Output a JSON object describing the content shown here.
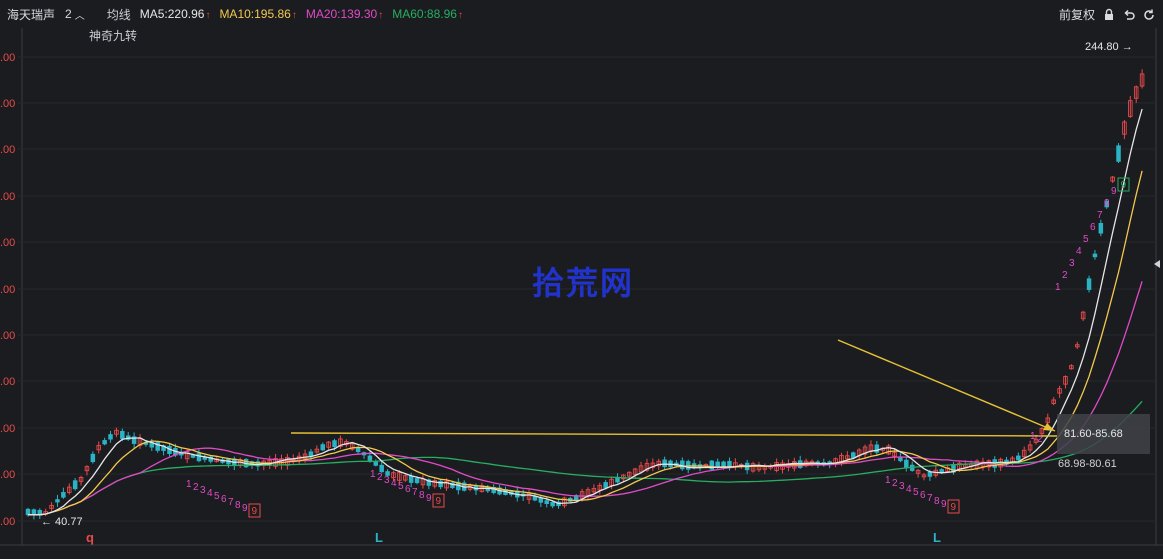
{
  "header": {
    "stock_name": "海天瑞声",
    "count_label": "2",
    "indicator_label": "均线",
    "ma_labels": [
      {
        "text": "MA5:220.96",
        "color": "#e6e6e6"
      },
      {
        "text": "MA10:195.86",
        "color": "#f2c94c"
      },
      {
        "text": "MA20:139.30",
        "color": "#e04bc6"
      },
      {
        "text": "MA60:88.96",
        "color": "#27ae60"
      }
    ],
    "arrow_glyph": "↑",
    "right_label": "前复权"
  },
  "subtitle": "神奇九转",
  "watermark": "拾荒网",
  "icons": [
    "chevron-up-icon",
    "lock-icon",
    "undo-icon",
    "refresh-icon"
  ],
  "colors": {
    "up": "#e84a4a",
    "down": "#2bb3c5",
    "ma5": "#e6e6e6",
    "ma10": "#f2c94c",
    "ma20": "#e04bc6",
    "ma60": "#27ae60",
    "axis_label": "#e84a4a",
    "annotation_line": "#e6c234",
    "nine_turn": "#e04bc6"
  },
  "chart_data": {
    "type": "candlestick",
    "y_tick_labels": [
      ".00",
      ".00",
      ".00",
      ".00",
      ".00",
      ".00",
      ".00",
      ".00",
      ".00",
      ".00",
      ".00"
    ],
    "annotations": {
      "high": "244.80",
      "low": "40.77",
      "box_upper": "81.60-85.68",
      "box_lower": "68.98-80.61"
    },
    "bottom_markers": [
      "q",
      "L",
      "L"
    ],
    "nine_turn_labels": [
      {
        "seq": "123456789",
        "badge": "9"
      },
      {
        "seq": "123456789",
        "badge": "9"
      },
      {
        "seq": "123456789",
        "badge": "9"
      },
      {
        "seq": "12",
        "badge": ""
      },
      {
        "seq": "123456789",
        "badge": "9"
      }
    ],
    "trend_note": "horizontal resistance line around 83 with arrow pointing to breakout"
  }
}
